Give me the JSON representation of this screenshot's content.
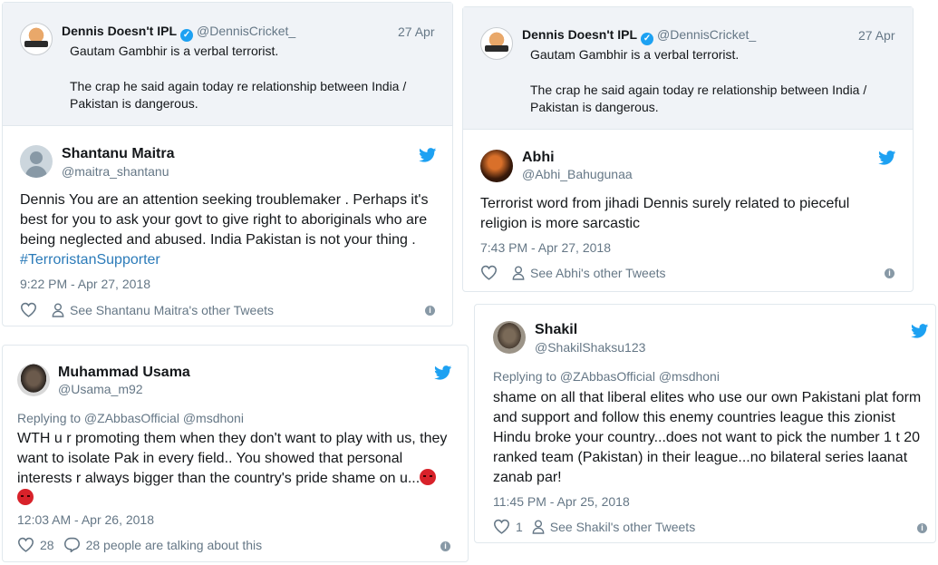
{
  "quoted": {
    "name": "Dennis Doesn't IPL",
    "handle": "@DennisCricket_",
    "date": "27 Apr",
    "line1": "Gautam Gambhir is a verbal terrorist.",
    "line2a": "The crap he said again today re relationship between India /",
    "line2b": "Pakistan is dangerous."
  },
  "tweets": {
    "shantanu": {
      "name": "Shantanu Maitra",
      "handle": "@maitra_shantanu",
      "lines": [
        "Dennis You are an attention seeking troublemaker . Perhaps it's",
        "best for you to ask your govt to give right to aboriginals who are",
        "being neglected and abused. India Pakistan is not your thing ."
      ],
      "hashtag": "#TerroristanSupporter",
      "time": "9:22 PM - Apr 27, 2018",
      "other": "See Shantanu Maitra's other Tweets"
    },
    "abhi": {
      "name": "Abhi",
      "handle": "@Abhi_Bahugunaa",
      "lines": [
        "Terrorist word from jihadi Dennis surely related to pieceful",
        "religion is more sarcastic"
      ],
      "time": "7:43 PM - Apr 27, 2018",
      "other": "See Abhi's other Tweets"
    },
    "usama": {
      "name": "Muhammad Usama",
      "handle": "@Usama_m92",
      "reply": "Replying to @ZAbbasOfficial @msdhoni",
      "lines": [
        "WTH u r promoting them when they don't want to play with us, they",
        "want to isolate Pak in every field.. You showed that personal",
        "interests r always bigger than the country's pride shame on u..."
      ],
      "time": "12:03 AM - Apr 26, 2018",
      "likes": "28",
      "talking": "28 people are talking about this"
    },
    "shakil": {
      "name": "Shakil",
      "handle": "@ShakilShaksu123",
      "reply": "Replying to @ZAbbasOfficial @msdhoni",
      "lines": [
        "shame on all that liberal elites who use our own Pakistani plat form",
        "and support and follow this enemy countries league this zionist",
        "Hindu broke your country...does not want to pick the number 1 t 20",
        "ranked team (Pakistan)  in their league...no bilateral series laanat",
        "zanab par!"
      ],
      "time": "11:45 PM - Apr 25, 2018",
      "likes": "1",
      "other": "See Shakil's other Tweets"
    }
  },
  "icons": {
    "verified": "verified-badge-icon",
    "bird": "twitter-bird-icon",
    "heart": "heart-icon",
    "person": "person-icon",
    "comment": "comment-icon",
    "info": "info-icon",
    "emoji": "angry-face-emoji"
  },
  "colors": {
    "twitter_blue": "#1da1f2",
    "link": "#2b7bb9",
    "muted": "#657786",
    "quote_bg": "#f0f3f7"
  }
}
